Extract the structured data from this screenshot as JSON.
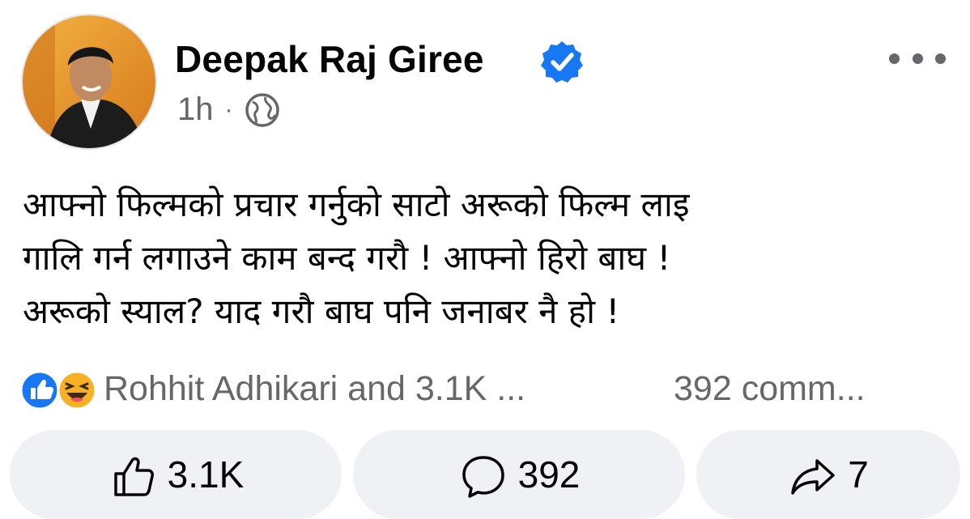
{
  "post": {
    "author": "Deepak Raj Giree",
    "verified": true,
    "timestamp": "1h",
    "separator": "·",
    "audience_icon": "globe-icon",
    "more_icon": "more-options-icon",
    "text_lines": [
      "आफ्नो फिल्मको प्रचार गर्नुको साटो अरूको फिल्म लाइ",
      "गालि गर्न लगाउने काम बन्द गरौ ! आफ्नो हिरो बाघ !",
      "अरूको स्याल? याद गरौ बाघ पनि जनाबर नै हो !"
    ]
  },
  "reactions": {
    "icons": [
      "like-reaction-icon",
      "haha-reaction-icon"
    ],
    "summary": "Rohhit Adhikari and 3.1K ...",
    "comments": "392 comm..."
  },
  "actions": {
    "like_count": "3.1K",
    "comment_count": "392",
    "share_count": "7"
  },
  "colors": {
    "accent_blue": "#1877f2",
    "secondary_text": "#65676b",
    "button_bg": "#eff1f4",
    "haha_yellow": "#f7b125"
  }
}
